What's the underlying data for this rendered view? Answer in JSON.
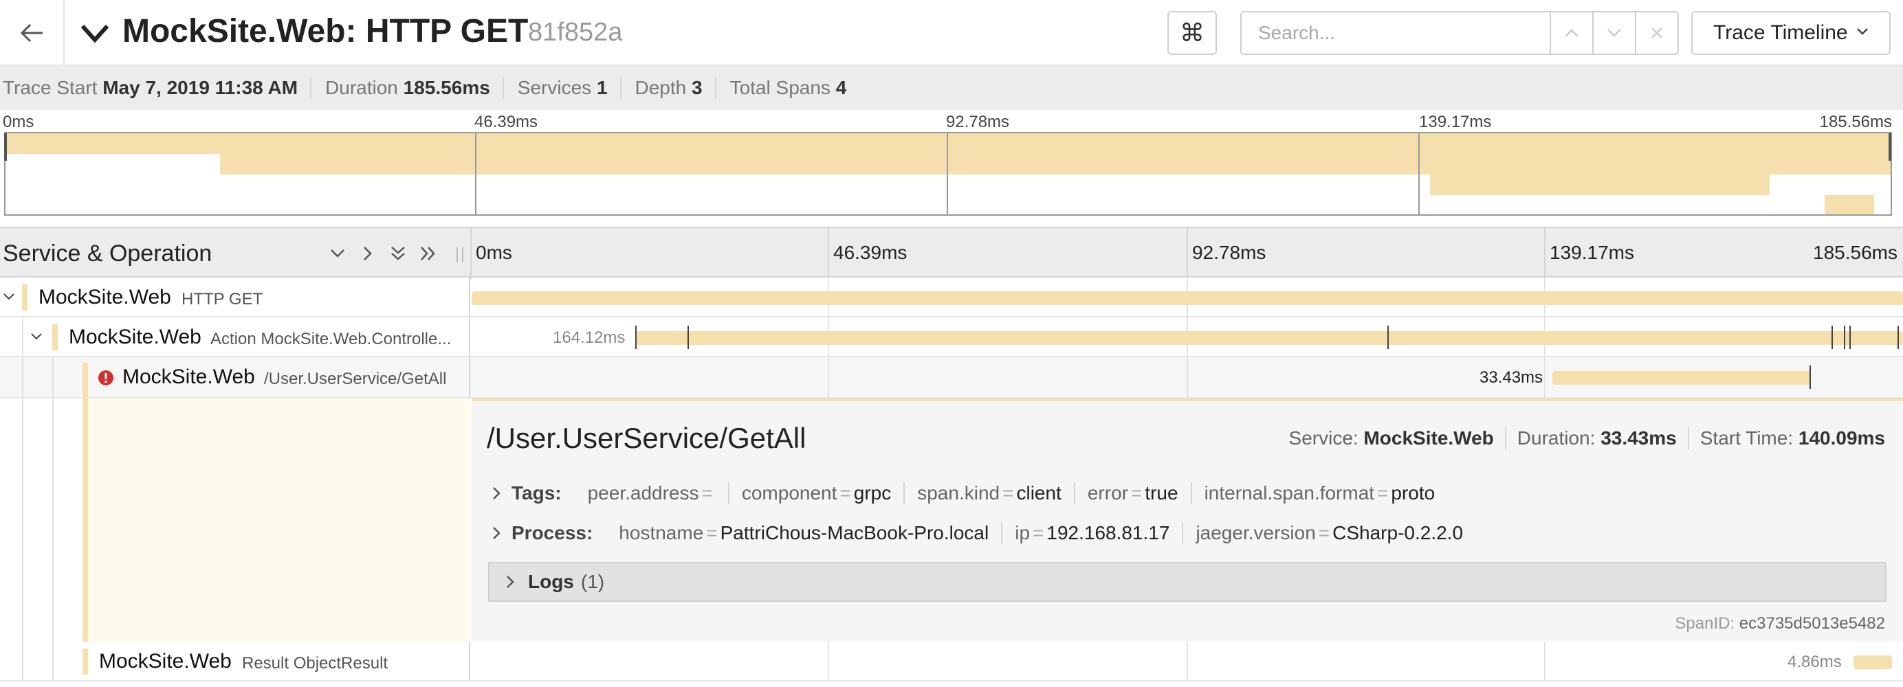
{
  "header": {
    "title": "MockSite.Web: HTTP GET",
    "trace_id": "81f852a",
    "search_placeholder": "Search...",
    "view_mode": "Trace Timeline",
    "cmd_symbol": "⌘"
  },
  "summary": {
    "trace_start_label": "Trace Start",
    "trace_start": "May 7, 2019 11:38 AM",
    "duration_label": "Duration",
    "duration": "185.56ms",
    "services_label": "Services",
    "services": "1",
    "depth_label": "Depth",
    "depth": "3",
    "total_spans_label": "Total Spans",
    "total_spans": "4"
  },
  "ticks": [
    "0ms",
    "46.39ms",
    "92.78ms",
    "139.17ms",
    "185.56ms"
  ],
  "timeline": {
    "column_title": "Service & Operation"
  },
  "spans": [
    {
      "service": "MockSite.Web",
      "operation": "HTTP GET",
      "duration_label": ""
    },
    {
      "service": "MockSite.Web",
      "operation": "Action MockSite.Web.Controlle...",
      "duration_label": "164.12ms"
    },
    {
      "service": "MockSite.Web",
      "operation": "/User.UserService/GetAll",
      "duration_label": "33.43ms"
    },
    {
      "service": "MockSite.Web",
      "operation": "Result ObjectResult",
      "duration_label": "4.86ms"
    }
  ],
  "detail": {
    "title": "/User.UserService/GetAll",
    "service_label": "Service:",
    "service": "MockSite.Web",
    "duration_label": "Duration:",
    "duration": "33.43ms",
    "start_label": "Start Time:",
    "start": "140.09ms",
    "tags_label": "Tags:",
    "tags": [
      {
        "key": "peer.address",
        "value": ""
      },
      {
        "key": "component",
        "value": "grpc"
      },
      {
        "key": "span.kind",
        "value": "client"
      },
      {
        "key": "error",
        "value": "true"
      },
      {
        "key": "internal.span.format",
        "value": "proto"
      }
    ],
    "process_label": "Process:",
    "process": [
      {
        "key": "hostname",
        "value": "PattriChous-MacBook-Pro.local"
      },
      {
        "key": "ip",
        "value": "192.168.81.17"
      },
      {
        "key": "jaeger.version",
        "value": "CSharp-0.2.2.0"
      }
    ],
    "logs_label": "Logs",
    "logs_count": "(1)",
    "span_id_label": "SpanID:",
    "span_id": "ec3735d5013e5482"
  },
  "colors": {
    "span_bar": "#f5dfad",
    "error_icon": "#d32f2f"
  }
}
